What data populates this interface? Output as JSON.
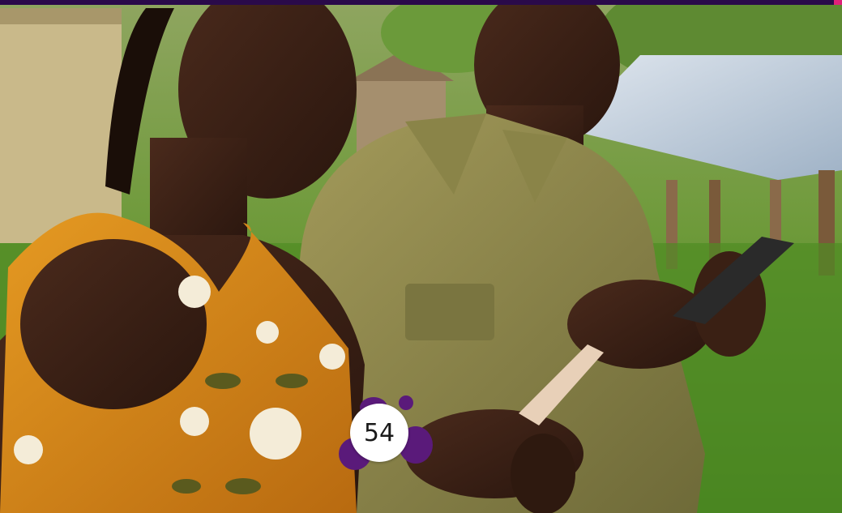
{
  "photo": {
    "subject": "photo-scene"
  },
  "badge": {
    "number": "54"
  },
  "colors": {
    "topbar": "#2a0a4a",
    "accent": "#e0207a",
    "badge_blob": "#5a1a7a"
  }
}
